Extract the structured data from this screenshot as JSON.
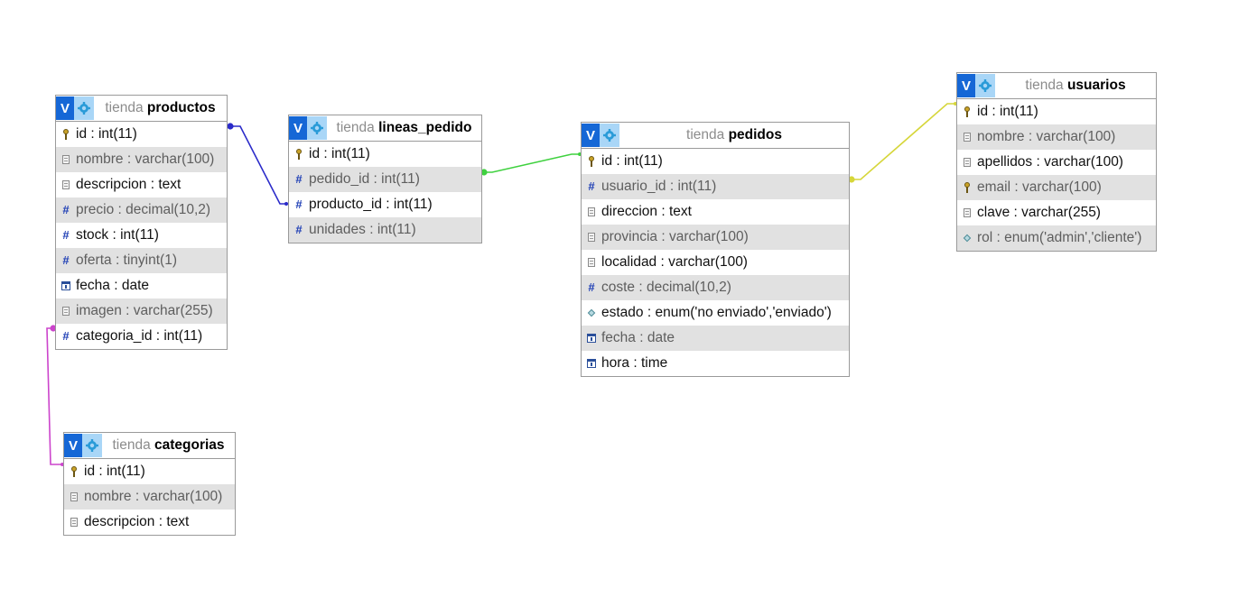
{
  "tables": {
    "productos": {
      "db": "tienda",
      "name": "productos",
      "columns": [
        {
          "text": "id : int(11)",
          "icon": "primary-key-icon"
        },
        {
          "text": "nombre : varchar(100)",
          "icon": "text-field-icon"
        },
        {
          "text": "descripcion : text",
          "icon": "text-field-icon"
        },
        {
          "text": "precio : decimal(10,2)",
          "icon": "numeric-field-icon"
        },
        {
          "text": "stock : int(11)",
          "icon": "numeric-field-icon"
        },
        {
          "text": "oferta : tinyint(1)",
          "icon": "numeric-field-icon"
        },
        {
          "text": "fecha : date",
          "icon": "date-field-icon"
        },
        {
          "text": "imagen : varchar(255)",
          "icon": "text-field-icon"
        },
        {
          "text": "categoria_id : int(11)",
          "icon": "numeric-field-icon"
        }
      ]
    },
    "lineas_pedido": {
      "db": "tienda",
      "name": "lineas_pedido",
      "columns": [
        {
          "text": "id : int(11)",
          "icon": "primary-key-icon"
        },
        {
          "text": "pedido_id : int(11)",
          "icon": "numeric-field-icon"
        },
        {
          "text": "producto_id : int(11)",
          "icon": "numeric-field-icon"
        },
        {
          "text": "unidades : int(11)",
          "icon": "numeric-field-icon"
        }
      ]
    },
    "pedidos": {
      "db": "tienda",
      "name": "pedidos",
      "columns": [
        {
          "text": "id : int(11)",
          "icon": "primary-key-icon"
        },
        {
          "text": "usuario_id : int(11)",
          "icon": "numeric-field-icon"
        },
        {
          "text": "direccion : text",
          "icon": "text-field-icon"
        },
        {
          "text": "provincia : varchar(100)",
          "icon": "text-field-icon"
        },
        {
          "text": "localidad : varchar(100)",
          "icon": "text-field-icon"
        },
        {
          "text": "coste : decimal(10,2)",
          "icon": "numeric-field-icon"
        },
        {
          "text": "estado : enum('no enviado','enviado')",
          "icon": "enum-field-icon"
        },
        {
          "text": "fecha : date",
          "icon": "date-field-icon"
        },
        {
          "text": "hora : time",
          "icon": "date-field-icon"
        }
      ]
    },
    "usuarios": {
      "db": "tienda",
      "name": "usuarios",
      "columns": [
        {
          "text": "id : int(11)",
          "icon": "primary-key-icon"
        },
        {
          "text": "nombre : varchar(100)",
          "icon": "text-field-icon"
        },
        {
          "text": "apellidos : varchar(100)",
          "icon": "text-field-icon"
        },
        {
          "text": "email : varchar(100)",
          "icon": "unique-key-icon"
        },
        {
          "text": "clave : varchar(255)",
          "icon": "text-field-icon"
        },
        {
          "text": "rol : enum('admin','cliente')",
          "icon": "enum-field-icon"
        }
      ]
    },
    "categorias": {
      "db": "tienda",
      "name": "categorias",
      "columns": [
        {
          "text": "id : int(11)",
          "icon": "primary-key-icon"
        },
        {
          "text": "nombre : varchar(100)",
          "icon": "text-field-icon"
        },
        {
          "text": "descripcion : text",
          "icon": "text-field-icon"
        }
      ]
    }
  },
  "header_buttons": {
    "toggle_label": "V",
    "toggle_icon": "toggle-v-icon",
    "options_icon": "gear-icon"
  },
  "relations": [
    {
      "name": "productos-lineas_pedido",
      "color": "#2b2bc9"
    },
    {
      "name": "pedidos-lineas_pedido",
      "color": "#3fd13f"
    },
    {
      "name": "usuarios-pedidos",
      "color": "#d6d63a"
    },
    {
      "name": "categorias-productos",
      "color": "#cc44cc"
    }
  ]
}
